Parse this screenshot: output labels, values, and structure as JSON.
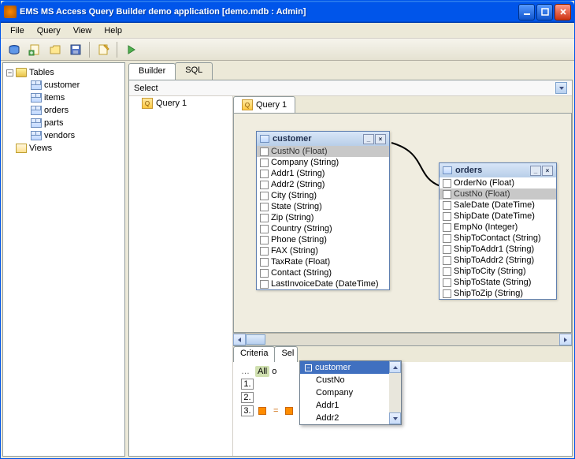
{
  "titlebar": {
    "title": "EMS MS Access Query Builder demo application [demo.mdb : Admin]"
  },
  "menu": {
    "file": "File",
    "query": "Query",
    "view": "View",
    "help": "Help"
  },
  "sidebar": {
    "tables_label": "Tables",
    "views_label": "Views",
    "tables": [
      {
        "name": "customer"
      },
      {
        "name": "items"
      },
      {
        "name": "orders"
      },
      {
        "name": "parts"
      },
      {
        "name": "vendors"
      }
    ]
  },
  "tabs": {
    "builder": "Builder",
    "sql": "SQL"
  },
  "select_label": "Select",
  "query_tree": {
    "q1": "Query 1"
  },
  "canvas_tabs": {
    "q1": "Query 1"
  },
  "customer_win": {
    "title": "customer",
    "fields": [
      "CustNo (Float)",
      "Company (String)",
      "Addr1 (String)",
      "Addr2 (String)",
      "City (String)",
      "State (String)",
      "Zip (String)",
      "Country (String)",
      "Phone (String)",
      "FAX (String)",
      "TaxRate (Float)",
      "Contact (String)",
      "LastInvoiceDate (DateTime)"
    ]
  },
  "orders_win": {
    "title": "orders",
    "fields": [
      "OrderNo (Float)",
      "CustNo (Float)",
      "SaleDate (DateTime)",
      "ShipDate (DateTime)",
      "EmpNo (Integer)",
      "ShipToContact (String)",
      "ShipToAddr1 (String)",
      "ShipToAddr2 (String)",
      "ShipToCity (String)",
      "ShipToState (String)",
      "ShipToZip (String)"
    ]
  },
  "criteria": {
    "tab_criteria": "Criteria",
    "tab_sel": "Sel",
    "all_text": "All",
    "of_text": " o",
    "n1": "1.",
    "n2": "2.",
    "n3": "3.",
    "eq": "="
  },
  "dropdown": {
    "head": "customer",
    "items": [
      "CustNo",
      "Company",
      "Addr1",
      "Addr2"
    ]
  }
}
